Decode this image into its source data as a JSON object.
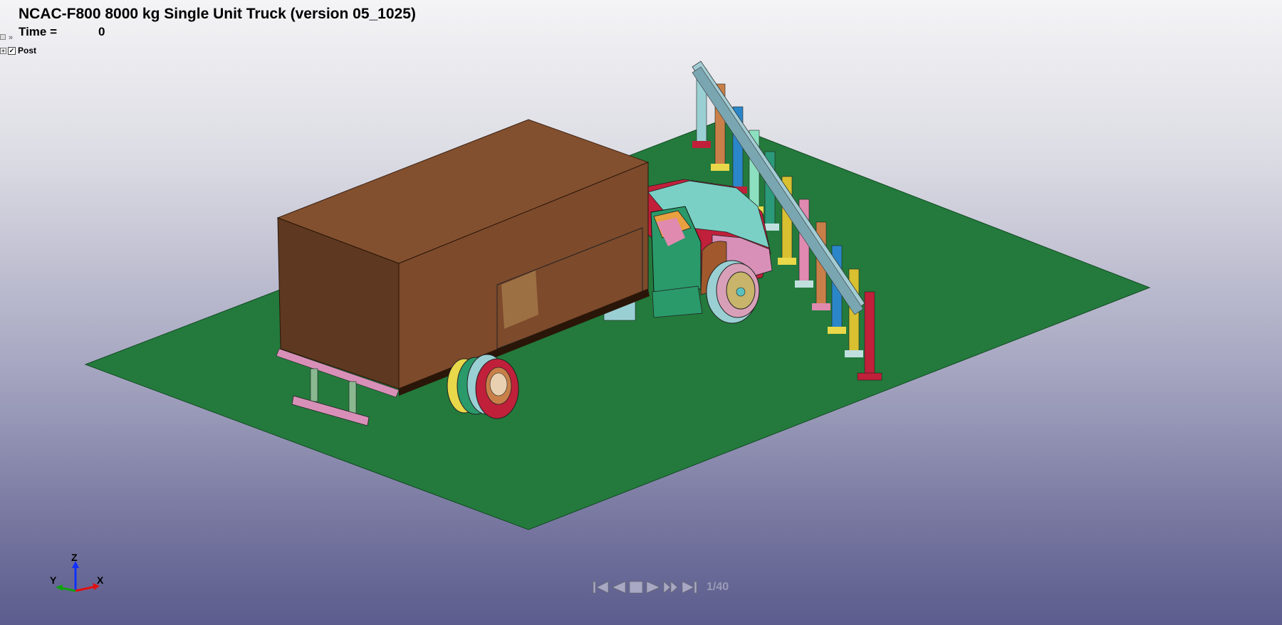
{
  "header": {
    "title": "NCAC-F800 8000 kg Single Unit Truck (version 05_1025)",
    "time_label": "Time =",
    "time_value": "0"
  },
  "tree": {
    "root_item_label": "Post"
  },
  "axes": {
    "z_label": "Z",
    "y_label": "Y",
    "x_label": "X",
    "z_color": "#1030ff",
    "y_color": "#10a010",
    "x_color": "#e01010"
  },
  "playback": {
    "frame_counter": "1/40",
    "buttons": [
      "first-frame-icon",
      "previous-frame-icon",
      "stop-icon",
      "play-icon",
      "next-frame-icon",
      "last-frame-icon"
    ]
  },
  "scene_colors": {
    "ground": "#237a3c",
    "cargo_box": "#7d4a2c",
    "cab": "#2a9a6a",
    "hood": "#7ad0c4",
    "rail": "#8cb8c4"
  }
}
